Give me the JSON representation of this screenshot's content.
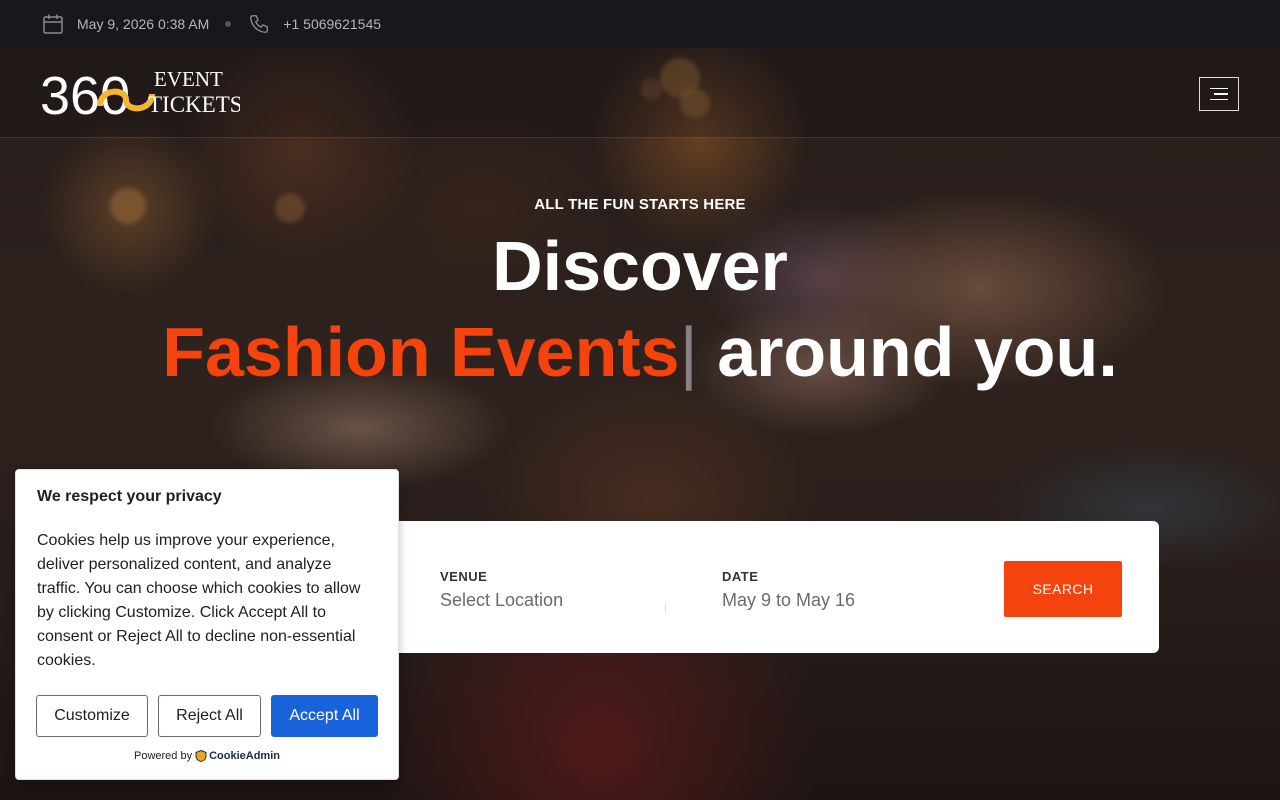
{
  "topbar": {
    "datetime": "May 9, 2026 0:38 AM",
    "phone": "+1 5069621545",
    "icons": [
      "calendar-icon",
      "phone-icon"
    ]
  },
  "header": {
    "logo_text_1": "EVENT",
    "logo_text_2": "TICKETS",
    "logo_number": "360",
    "menu_icon": "menu-icon"
  },
  "hero": {
    "eyebrow": "ALL THE FUN STARTS HERE",
    "headline_line1": "Discover",
    "headline_accent": "Fashion Events",
    "headline_cursor": "|",
    "headline_rest": " around you."
  },
  "search": {
    "venue_label": "VENUE",
    "venue_value": "Select Location",
    "date_label": "DATE",
    "date_value": "May 9 to May 16",
    "button_label": "SEARCH"
  },
  "cookie": {
    "title": "We respect your privacy",
    "body": "Cookies help us improve your experience, deliver personalized content, and analyze traffic. You can choose which cookies to allow by clicking Customize. Click Accept All to consent or Reject All to decline non-essential cookies.",
    "customize_label": "Customize",
    "reject_label": "Reject All",
    "accept_label": "Accept All",
    "powered_by": "Powered by",
    "brand": "CookieAdmin"
  },
  "colors": {
    "accent": "#f4430d",
    "accept_blue": "#1863dc",
    "logo_gold": "#f2b630",
    "topbar_bg": "#17181d"
  }
}
